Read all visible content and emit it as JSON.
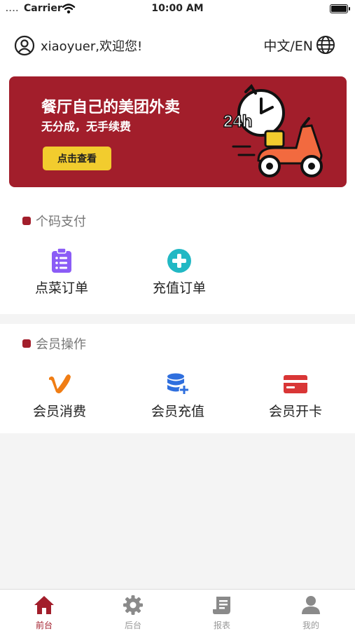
{
  "status_bar": {
    "signal": "....",
    "carrier": "Carrier",
    "time": "10:00 AM"
  },
  "header": {
    "welcome": "xiaoyuer,欢迎您!",
    "language": "中文/EN"
  },
  "banner": {
    "title": "餐厅自己的美团外卖",
    "subtitle": "无分成，无手续费",
    "button": "点击查看",
    "badge": "24h"
  },
  "sections": [
    {
      "title": "个码支付",
      "items": [
        {
          "label": "点菜订单",
          "icon": "clipboard-list-icon",
          "color": "#8b5cf6"
        },
        {
          "label": "充值订单",
          "icon": "plus-circle-icon",
          "color": "#22b8c4"
        }
      ]
    },
    {
      "title": "会员操作",
      "items": [
        {
          "label": "会员消费",
          "icon": "v-logo-icon",
          "color": "#f07d14"
        },
        {
          "label": "会员充值",
          "icon": "database-plus-icon",
          "color": "#2f6fde"
        },
        {
          "label": "会员开卡",
          "icon": "credit-card-icon",
          "color": "#d93636"
        }
      ]
    }
  ],
  "tabbar": [
    {
      "label": "前台",
      "icon": "home-icon",
      "active": true
    },
    {
      "label": "后台",
      "icon": "gear-icon",
      "active": false
    },
    {
      "label": "报表",
      "icon": "report-icon",
      "active": false
    },
    {
      "label": "我的",
      "icon": "user-icon",
      "active": false
    }
  ],
  "colors": {
    "brand": "#a21e2b",
    "accent_yellow": "#f2cc2e",
    "tab_inactive": "#999999"
  }
}
